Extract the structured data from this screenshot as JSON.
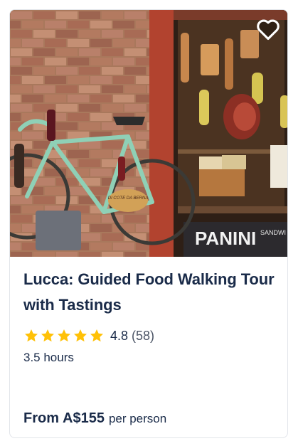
{
  "activity": {
    "title": "Lucca: Guided Food Walking Tour with Tastings",
    "rating": "4.8",
    "rating_fraction": 0.96,
    "review_count": "(58)",
    "duration": "3.5 hours",
    "price_prefix": "From",
    "price": "A$155",
    "price_unit": "per person"
  },
  "photo": {
    "bike_sign": "DI COTE DA BERNA",
    "panini_sign": "PANINI",
    "small_sign": "SANDWI"
  },
  "icons": {
    "favorite": "heart-outline-icon",
    "rating_star": "star-icon"
  },
  "colors": {
    "title": "#1a2b49",
    "star": "#ffc107",
    "border": "#e2e5ea"
  }
}
